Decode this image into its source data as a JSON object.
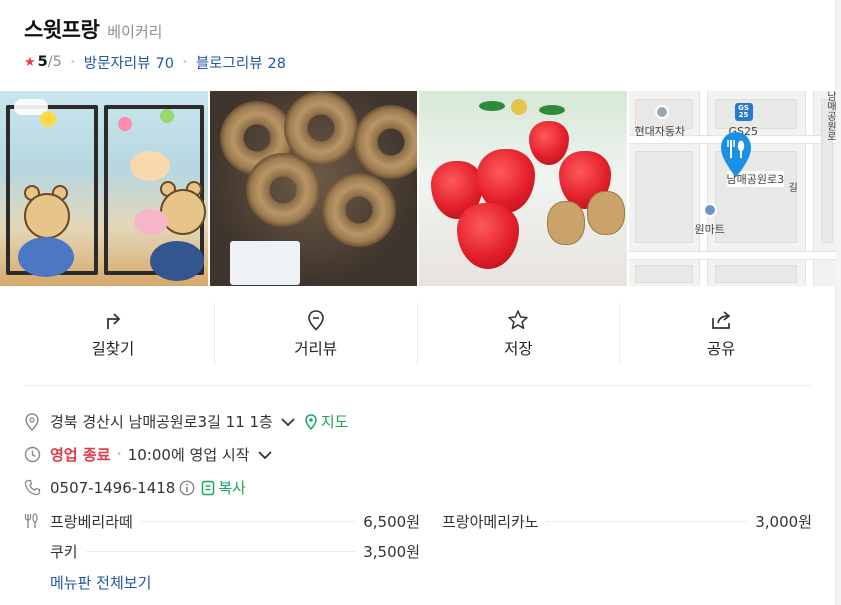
{
  "place": {
    "name": "스윗프랑",
    "category": "베이커리",
    "rating": "5",
    "rating_max": "/5",
    "visitor_reviews_label": "방문자리뷰",
    "visitor_reviews_count": "70",
    "blog_reviews_label": "블로그리뷰",
    "blog_reviews_count": "28"
  },
  "photos": [
    {
      "alt": "store-window-photo"
    },
    {
      "alt": "donuts-photo"
    },
    {
      "alt": "strawberry-cake-photo"
    },
    {
      "alt": "map-thumbnail"
    }
  ],
  "map_thumb": {
    "poi_1": "현대자동차",
    "poi_2": "GS25",
    "gs_badge": "GS\n25",
    "road": "남매공원로3",
    "road_short": "길",
    "poi_3": "원마트",
    "right_edge_label": "남매공원로"
  },
  "actions": [
    {
      "label": "길찾기",
      "icon": "directions-icon"
    },
    {
      "label": "거리뷰",
      "icon": "location-pin-icon"
    },
    {
      "label": "저장",
      "icon": "star-icon"
    },
    {
      "label": "공유",
      "icon": "share-icon"
    }
  ],
  "info": {
    "address": "경북 경산시 남매공원로3길 11 1층",
    "map_link": "지도",
    "status": "영업 종료",
    "hours": "10:00에 영업 시작",
    "phone": "0507-1496-1418",
    "copy_label": "복사"
  },
  "menu": {
    "items": [
      {
        "name": "프랑베리라떼",
        "price": "6,500원"
      },
      {
        "name": "프랑아메리카노",
        "price": "3,000원"
      },
      {
        "name": "쿠키",
        "price": "3,500원"
      }
    ],
    "more_label": "메뉴판 전체보기"
  },
  "colors": {
    "accent_blue": "#2456a6",
    "closed_red": "#e4374b",
    "map_green": "#19a85a",
    "pin_blue": "#1a8fe6"
  }
}
